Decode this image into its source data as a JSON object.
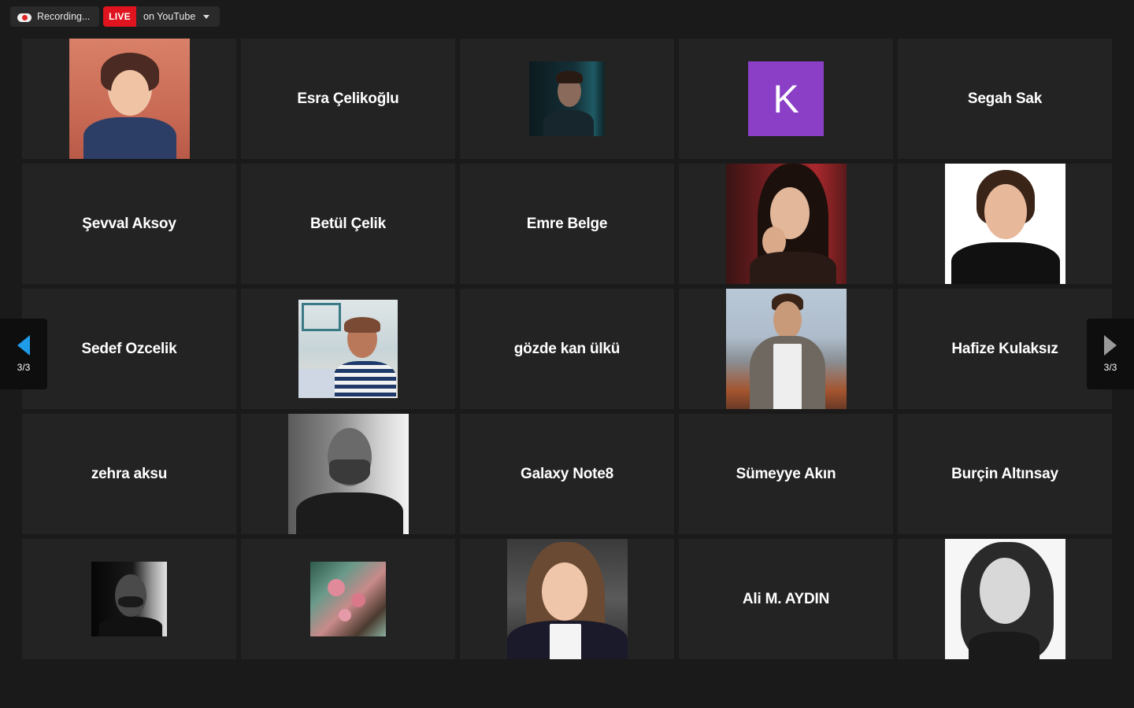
{
  "topbar": {
    "recording_label": "Recording...",
    "live_badge": "LIVE",
    "live_target": "on YouTube"
  },
  "pagination": {
    "left_page": "3/3",
    "right_page": "3/3"
  },
  "colors": {
    "live_red": "#e0141e",
    "avatar_purple": "#8a3fc6",
    "nav_arrow_blue": "#1e9be9",
    "tile_bg": "#232323"
  },
  "participants": [
    {
      "name": "",
      "kind": "photo"
    },
    {
      "name": "Esra Çelikoğlu",
      "kind": "name"
    },
    {
      "name": "",
      "kind": "photo"
    },
    {
      "name": "",
      "kind": "avatar",
      "initial": "K"
    },
    {
      "name": "Segah Sak",
      "kind": "name"
    },
    {
      "name": "Şevval Aksoy",
      "kind": "name"
    },
    {
      "name": "Betül Çelik",
      "kind": "name"
    },
    {
      "name": "Emre Belge",
      "kind": "name"
    },
    {
      "name": "",
      "kind": "photo"
    },
    {
      "name": "",
      "kind": "photo"
    },
    {
      "name": "Sedef Ozcelik",
      "kind": "name"
    },
    {
      "name": "",
      "kind": "photo"
    },
    {
      "name": "gözde kan ülkü",
      "kind": "name"
    },
    {
      "name": "",
      "kind": "photo"
    },
    {
      "name": "Hafize Kulaksız",
      "kind": "name"
    },
    {
      "name": "zehra aksu",
      "kind": "name"
    },
    {
      "name": "",
      "kind": "photo"
    },
    {
      "name": "Galaxy Note8",
      "kind": "name"
    },
    {
      "name": "Sümeyye Akın",
      "kind": "name"
    },
    {
      "name": "Burçin Altınsay",
      "kind": "name"
    },
    {
      "name": "",
      "kind": "photo"
    },
    {
      "name": "",
      "kind": "photo"
    },
    {
      "name": "",
      "kind": "photo"
    },
    {
      "name": "Ali M. AYDIN",
      "kind": "name"
    },
    {
      "name": "",
      "kind": "photo"
    }
  ]
}
